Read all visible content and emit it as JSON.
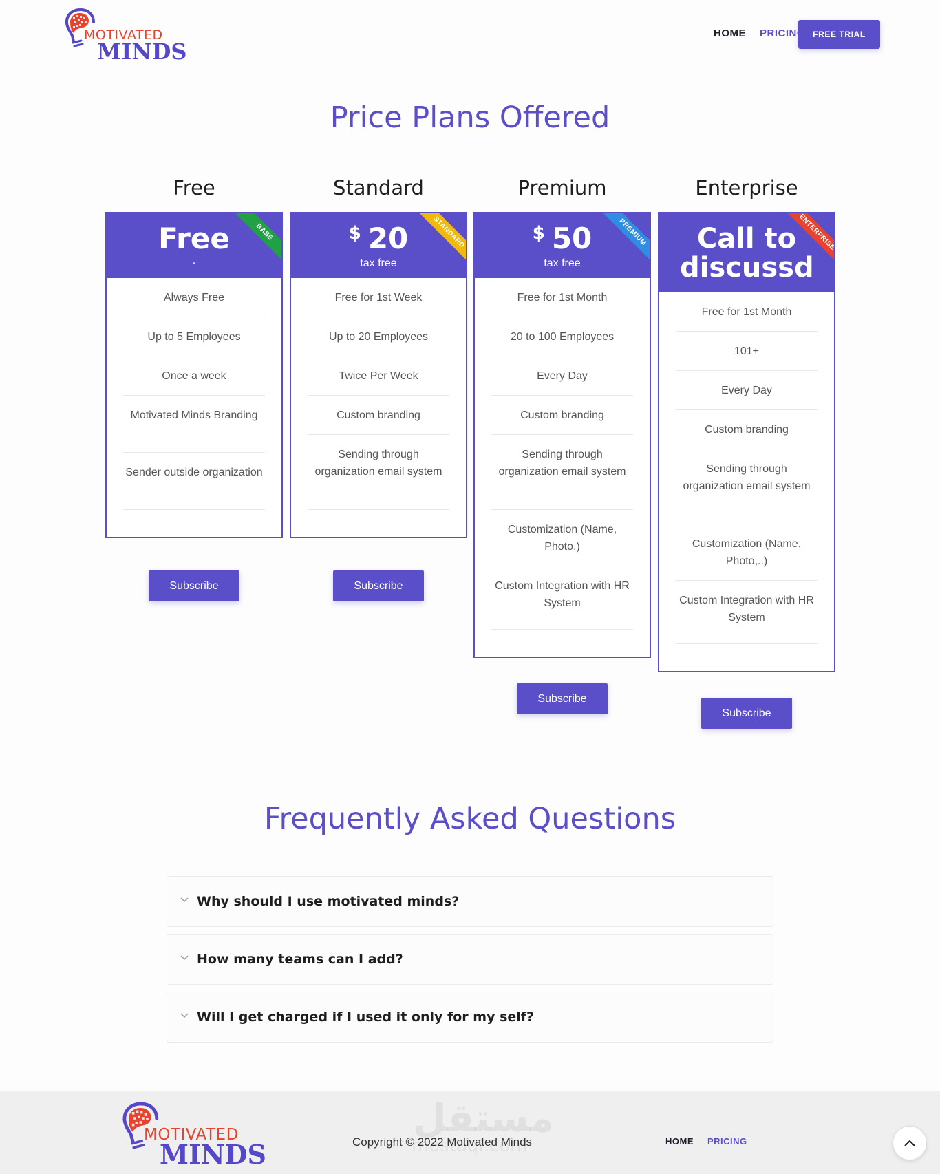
{
  "brand": {
    "line1": "MOTIVATED",
    "line2": "MINDS"
  },
  "nav": {
    "home": "HOME",
    "pricing": "PRICING",
    "trial": "FREE TRIAL"
  },
  "pricing": {
    "title": "Price Plans Offered",
    "plans": [
      {
        "name": "Free",
        "headline": "Free",
        "sub": ".",
        "ribbon": "BASE",
        "ribbon_color": "#21a045",
        "features": [
          "Always Free",
          "Up to 5 Employees",
          "Once a week",
          "Motivated Minds Branding",
          "Sender outside organization"
        ],
        "cta": "Subscribe"
      },
      {
        "name": "Standard",
        "currency": "$",
        "price": "20",
        "sub": "tax free",
        "ribbon": "STANDARD",
        "ribbon_color": "#f0b90b",
        "features": [
          "Free for 1st Week",
          "Up to 20 Employees",
          "Twice Per Week",
          "Custom branding",
          "Sending through organization email system"
        ],
        "cta": "Subscribe"
      },
      {
        "name": "Premium",
        "currency": "$",
        "price": "50",
        "sub": "tax free",
        "ribbon": "PREMIUM",
        "ribbon_color": "#2f8de4",
        "features": [
          "Free for 1st Month",
          "20 to 100 Employees",
          "Every Day",
          "Custom branding",
          "Sending through organization email system",
          "Customization (Name, Photo,)",
          "Custom Integration with HR System"
        ],
        "cta": "Subscribe"
      },
      {
        "name": "Enterprise",
        "headline": "Call to discussd",
        "ribbon": "ENTERPRISE",
        "ribbon_color": "#e8432e",
        "features": [
          "Free for 1st Month",
          "101+",
          "Every Day",
          "Custom branding",
          "Sending through organization email system",
          "Customization (Name, Photo,..)",
          "Custom Integration with HR System"
        ],
        "cta": "Subscribe"
      }
    ]
  },
  "faq": {
    "title": "Frequently Asked Questions",
    "items": [
      "Why should I use motivated minds?",
      "How many teams can I add?",
      "Will I get charged if I used it only for my self?"
    ]
  },
  "footer": {
    "copyright": "Copyright © 2022 Motivated Minds",
    "watermark": "مستقل",
    "watermark_sub": "mostaql.com",
    "home": "HOME",
    "pricing": "PRICING"
  },
  "icons": {
    "faq_toggle": "chevron-down-icon",
    "scroll_top": "chevron-up-icon",
    "logo": "brain-bulb-icon"
  },
  "colors": {
    "accent": "#5b4fc9",
    "brand_red": "#e8432e"
  }
}
